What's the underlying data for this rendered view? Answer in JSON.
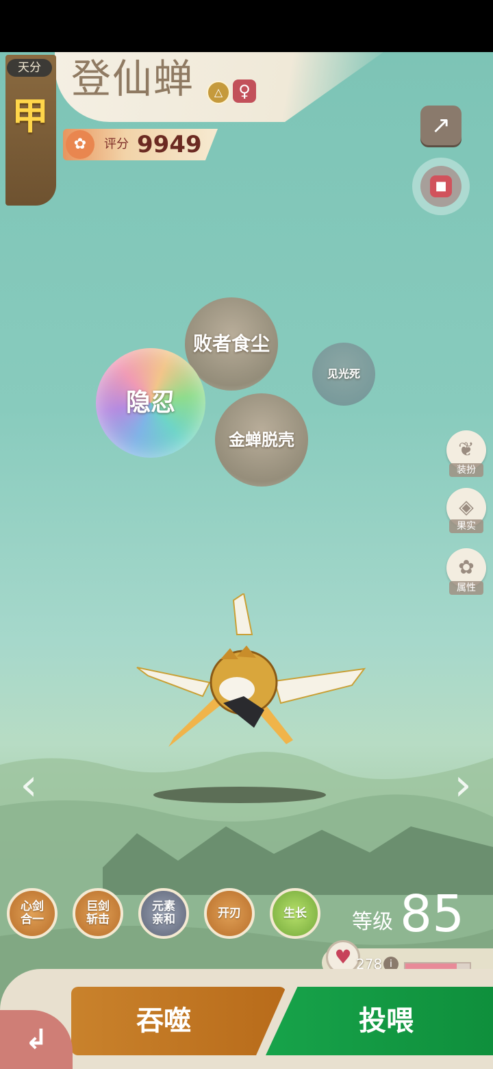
{
  "header": {
    "talent_label": "天分",
    "talent_grade": "甲",
    "pet_name": "登仙蝉",
    "gender_symbol": "♀",
    "score_label": "评分",
    "score_value": "9949"
  },
  "bubbles": [
    "败者食尘",
    "隐忍",
    "金蝉脱壳",
    "见光死"
  ],
  "side_menu": [
    {
      "label": "装扮",
      "icon": "butterfly-icon"
    },
    {
      "label": "果实",
      "icon": "fruit-icon"
    },
    {
      "label": "属性",
      "icon": "paw-icon"
    }
  ],
  "skills": [
    {
      "label": "心剑合一",
      "color": "#c88a42"
    },
    {
      "label": "巨剑斩击",
      "color": "#c88a42"
    },
    {
      "label": "元素亲和",
      "color": "#727a8e"
    },
    {
      "label": "开刃",
      "color": "#c88a42"
    },
    {
      "label": "生长",
      "color": "#8fc04c"
    }
  ],
  "level": {
    "label": "等级",
    "value": "85"
  },
  "hp": {
    "value": "278",
    "fill_fraction": 0.8
  },
  "actions": {
    "swallow": "吞噬",
    "feed": "投喂"
  },
  "colors": {
    "swallow_button": "#c17a26",
    "feed_button": "#139a44",
    "accent": "#ffd64a"
  }
}
